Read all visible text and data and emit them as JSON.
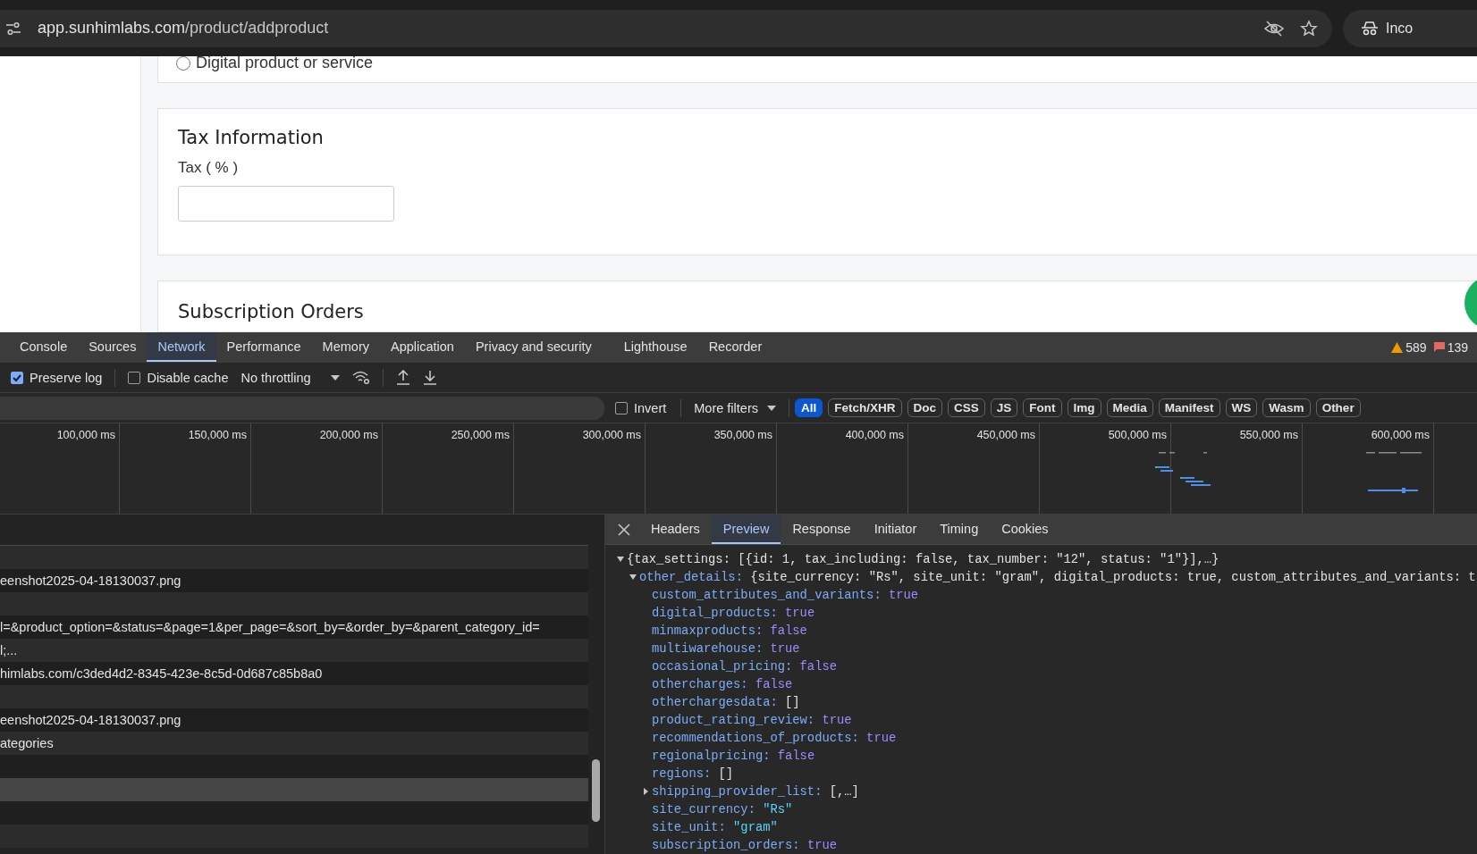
{
  "browser": {
    "url_host": "app.sunhimlabs.com",
    "url_path": "/product/addproduct",
    "profile_label": "Inco"
  },
  "page": {
    "radio_option": {
      "label": "Digital product or service",
      "selected": false
    },
    "tax_card": {
      "title": "Tax Information",
      "field_label": "Tax ( % )"
    },
    "next_card": {
      "title": "Subscription Orders"
    }
  },
  "devtools": {
    "tabs": [
      {
        "label": "Console",
        "selected": false
      },
      {
        "label": "Sources",
        "selected": false
      },
      {
        "label": "Network",
        "selected": true
      },
      {
        "label": "Performance",
        "selected": false
      },
      {
        "label": "Memory",
        "selected": false
      },
      {
        "label": "Application",
        "selected": false
      },
      {
        "label": "Privacy and security",
        "selected": false
      },
      {
        "label": "Lighthouse",
        "selected": false
      },
      {
        "label": "Recorder",
        "selected": false
      }
    ],
    "warnings": "589",
    "errors": "139",
    "toolbar": {
      "preserve_log": {
        "label": "Preserve log",
        "checked": true
      },
      "disable_cache": {
        "label": "Disable cache",
        "checked": false
      },
      "throttling": "No throttling"
    },
    "filter": {
      "invert": {
        "label": "Invert",
        "checked": false
      },
      "more_filters": "More filters",
      "chips": [
        {
          "label": "All",
          "selected": true
        },
        {
          "label": "Fetch/XHR",
          "selected": false
        },
        {
          "label": "Doc",
          "selected": false
        },
        {
          "label": "CSS",
          "selected": false
        },
        {
          "label": "JS",
          "selected": false
        },
        {
          "label": "Font",
          "selected": false
        },
        {
          "label": "Img",
          "selected": false
        },
        {
          "label": "Media",
          "selected": false
        },
        {
          "label": "Manifest",
          "selected": false
        },
        {
          "label": "WS",
          "selected": false
        },
        {
          "label": "Wasm",
          "selected": false
        },
        {
          "label": "Other",
          "selected": false
        }
      ]
    },
    "timeline_ticks": [
      "100,000 ms",
      "150,000 ms",
      "200,000 ms",
      "250,000 ms",
      "300,000 ms",
      "350,000 ms",
      "400,000 ms",
      "450,000 ms",
      "500,000 ms",
      "550,000 ms",
      "600,000 ms"
    ],
    "requests": [
      {
        "selected": false
      },
      {
        "name": "eenshot2025-04-18130037.png",
        "selected": false
      },
      {
        "selected": false
      },
      {
        "name": "l=&product_option=&status=&page=1&per_page=&sort_by=&order_by=&parent_category_id=",
        "selected": false
      },
      {
        "name": "l;...",
        "selected": false
      },
      {
        "name": "himlabs.com/c3ded4d2-8345-423e-8c5d-0d687c85b8a0",
        "selected": false
      },
      {
        "selected": false
      },
      {
        "name": "eenshot2025-04-18130037.png",
        "selected": false
      },
      {
        "name": "ategories",
        "selected": false
      },
      {
        "selected": false
      },
      {
        "selected": true
      },
      {
        "selected": false
      },
      {
        "selected": false
      }
    ],
    "detail": {
      "tabs": [
        {
          "label": "Headers",
          "selected": false
        },
        {
          "label": "Preview",
          "selected": true
        },
        {
          "label": "Response",
          "selected": false
        },
        {
          "label": "Initiator",
          "selected": false
        },
        {
          "label": "Timing",
          "selected": false
        },
        {
          "label": "Cookies",
          "selected": false
        }
      ],
      "preview": [
        {
          "kind": "object",
          "expanded": true,
          "summary": "{tax_settings: [{id: 1, tax_including: false, tax_number: \"12\", status: \"1\"}],…}",
          "children": [
            {
              "kind": "object",
              "key": "other_details:",
              "expanded": true,
              "summary": "{site_currency: \"Rs\", site_unit: \"gram\", digital_products: true, custom_attributes_and_variants: t",
              "children": [
                {
                  "kind": "boolean",
                  "key": "custom_attributes_and_variants:",
                  "value": "true"
                },
                {
                  "kind": "boolean",
                  "key": "digital_products:",
                  "value": "true"
                },
                {
                  "kind": "boolean",
                  "key": "minmaxproducts:",
                  "value": "false"
                },
                {
                  "kind": "boolean",
                  "key": "multiwarehouse:",
                  "value": "true"
                },
                {
                  "kind": "boolean",
                  "key": "occasional_pricing:",
                  "value": "false"
                },
                {
                  "kind": "boolean",
                  "key": "othercharges:",
                  "value": "false"
                },
                {
                  "kind": "array",
                  "key": "otherchargesdata:",
                  "value": "[]"
                },
                {
                  "kind": "boolean",
                  "key": "product_rating_review:",
                  "value": "true"
                },
                {
                  "kind": "boolean",
                  "key": "recommendations_of_products:",
                  "value": "true"
                },
                {
                  "kind": "boolean",
                  "key": "regionalpricing:",
                  "value": "false"
                },
                {
                  "kind": "array",
                  "key": "regions:",
                  "value": "[]"
                },
                {
                  "kind": "object",
                  "key": "shipping_provider_list:",
                  "expanded": false,
                  "summary": "[,…]"
                },
                {
                  "kind": "string",
                  "key": "site_currency:",
                  "value": "\"Rs\""
                },
                {
                  "kind": "string",
                  "key": "site_unit:",
                  "value": "\"gram\""
                },
                {
                  "kind": "boolean",
                  "key": "subscription_orders:",
                  "value": "true"
                }
              ]
            }
          ]
        }
      ]
    }
  }
}
